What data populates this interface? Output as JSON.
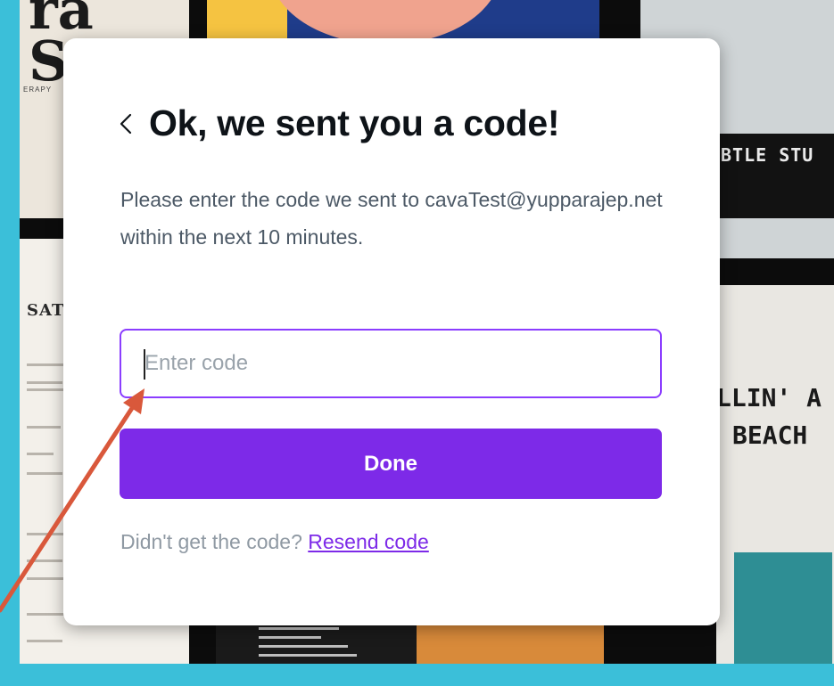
{
  "modal": {
    "back_icon": "chevron-left-icon",
    "title": "Ok, we sent you a code!",
    "description": "Please enter the code we sent to cavaTest@yupparajep.net within the next 10 minutes.",
    "code_input": {
      "placeholder": "Enter code",
      "value": ""
    },
    "done_label": "Done",
    "footer_prompt": "Didn't get the code?",
    "resend_label": "Resend code"
  },
  "background": {
    "tile_a_text": "ra\nSp",
    "tile_a_sub": "ERAPY",
    "tile_b_text": "SAT",
    "tile_d_text": "BTLE STU",
    "tile_e_line1": "LLIN' A",
    "tile_e_line2": "BEACH"
  },
  "colors": {
    "accent": "#7d2ae8",
    "input_border": "#8b3dff",
    "arrow": "#d9583b",
    "page_background": "#3bbfd9"
  }
}
